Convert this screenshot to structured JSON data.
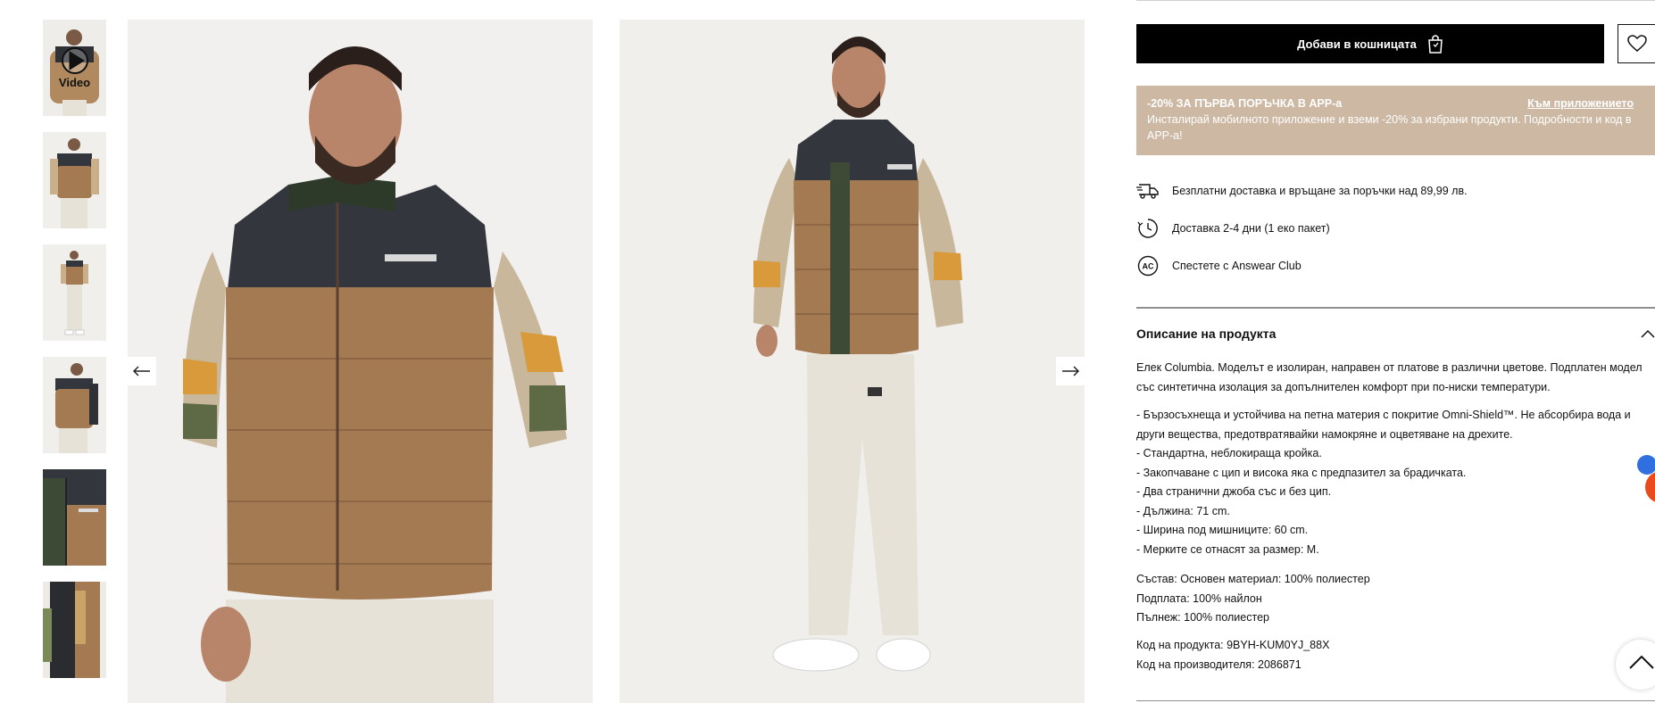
{
  "gallery": {
    "video_label": "Video",
    "thumbnails": [
      "thumb-video",
      "thumb-front",
      "thumb-full",
      "thumb-side",
      "thumb-detail",
      "thumb-open"
    ]
  },
  "actions": {
    "add_to_cart": "Добави в кошницата",
    "cart_icon": "shopping-bag-icon",
    "wishlist_icon": "heart-icon"
  },
  "promo": {
    "title": "-20% ЗА ПЪРВА ПОРЪЧКА В APP-a",
    "link": "Към приложението",
    "text": "Инсталирай мобилното приложение и вземи -20% за избрани продукти. Подробности и код в APP-a!",
    "bg_color": "#cdb8a3"
  },
  "info": {
    "shipping": "Безплатни доставка и връщане за поръчки над 89,99 лв.",
    "delivery": "Доставка 2-4 дни (1 еко пакет)",
    "club": "Спестете с Answear Club"
  },
  "description": {
    "heading": "Описание на продукта",
    "intro": "Елек Columbia. Моделът е изолиран, направен от платове в различни цветове. Подплатен модел със синтетична изолация за допълнителен комфорт при по-ниски температури.",
    "features": [
      "- Бързосъхнеща и устойчива на петна материя с покритие Omni-Shield™. Не абсорбира вода и други вещества, предотвратявайки намокряне и оцветяване на дрехите.",
      "- Стандартна, неблокираща кройка.",
      "- Закопчаване с цип и висока яка с предпазител за брадичката.",
      "- Два странични джоба със и без цип.",
      "- Дължина: 71 cm.",
      "- Ширина под мишниците: 60 cm.",
      "- Мерките се отнасят за размер: M."
    ],
    "composition": [
      "Състав: Основен материал: 100% полиестер",
      "Подплата: 100% найлон",
      "Пълнеж: 100% полиестер"
    ],
    "codes": [
      "Код на продукта: 9BYH-KUM0YJ_88X",
      "Код на производителя: 2086871"
    ]
  },
  "colors": {
    "vest_brown": "#a47a52",
    "vest_black": "#33363c",
    "pants": "#e6e2d8"
  }
}
